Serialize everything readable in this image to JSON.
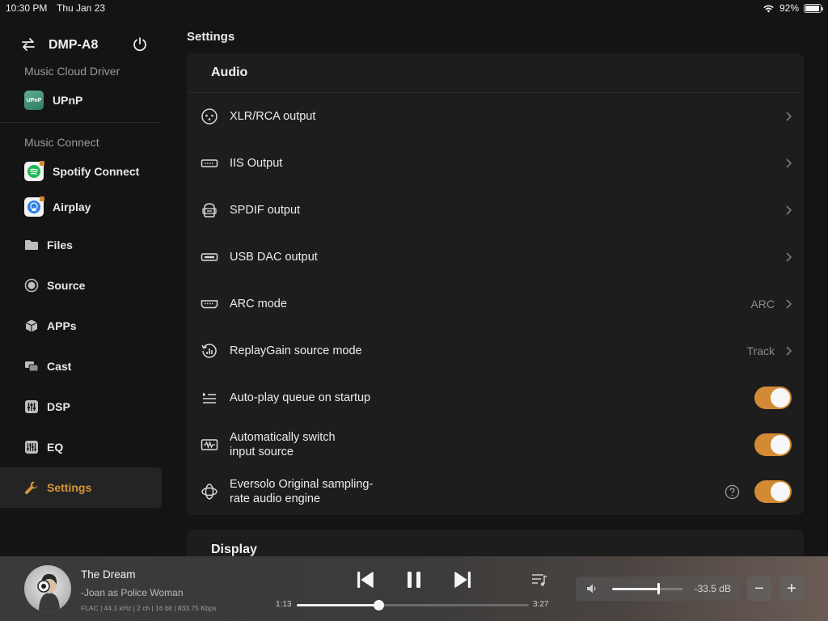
{
  "status_bar": {
    "time": "10:30 PM",
    "date": "Thu Jan 23",
    "battery": "92%",
    "battery_level": 0.92
  },
  "sidebar": {
    "device_name": "DMP-A8",
    "cloud_section": "Music Cloud Driver",
    "upnp_label": "UPnP",
    "upnp_badge": "UPnP",
    "connect_section": "Music Connect",
    "spotify_label": "Spotify Connect",
    "airplay_label": "Airplay",
    "items": [
      {
        "label": "Files",
        "icon": "folder-icon"
      },
      {
        "label": "Source",
        "icon": "source-icon"
      },
      {
        "label": "APPs",
        "icon": "cube-icon"
      },
      {
        "label": "Cast",
        "icon": "cast-icon"
      },
      {
        "label": "DSP",
        "icon": "dsp-icon"
      },
      {
        "label": "EQ",
        "icon": "eq-icon"
      },
      {
        "label": "Settings",
        "icon": "wrench-icon",
        "active": true
      }
    ]
  },
  "main": {
    "title": "Settings",
    "audio": {
      "header": "Audio",
      "rows": {
        "xlr": {
          "label": "XLR/RCA output"
        },
        "iis": {
          "label": "IIS Output"
        },
        "spdif": {
          "label": "SPDIF output"
        },
        "usb_dac": {
          "label": "USB DAC output"
        },
        "arc": {
          "label": "ARC mode",
          "value": "ARC"
        },
        "replaygain": {
          "label": "ReplayGain source mode",
          "value": "Track"
        },
        "autoplay": {
          "label": "Auto-play queue on startup",
          "on": true
        },
        "autoswitch": {
          "label": "Automatically switch input source",
          "on": true
        },
        "engine": {
          "label": "Eversolo Original sampling-rate audio engine",
          "on": true
        }
      }
    },
    "display": {
      "header": "Display"
    }
  },
  "player": {
    "title": "The Dream",
    "artist": "-Joan as Police Woman",
    "format": "FLAC | 44.1 kHz | 2 ch | 16 bit | 833.75 Kbps",
    "elapsed": "1:13",
    "total": "3:27",
    "progress": 0.353,
    "volume_label": "-33.5 dB",
    "volume_level": 0.64,
    "minus": "−",
    "plus": "+"
  },
  "colors": {
    "accent": "#d38a35",
    "background": "#141414",
    "card": "#1d1d1d"
  }
}
